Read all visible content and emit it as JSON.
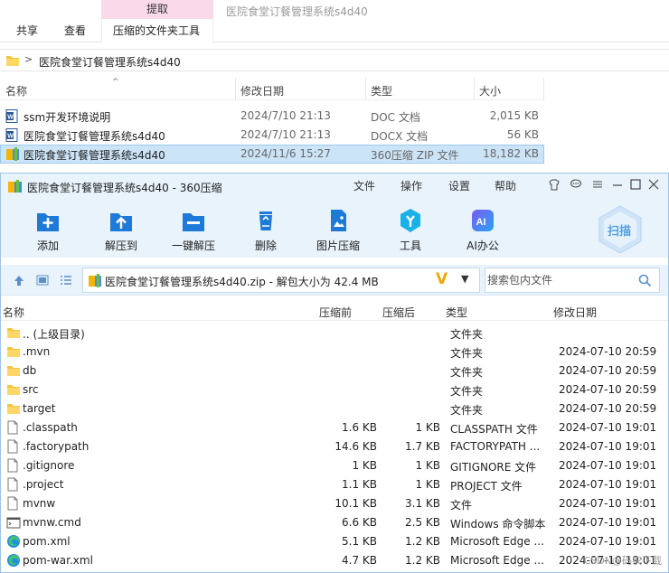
{
  "explorer": {
    "context_tab_header": "提取",
    "window_title": "医院食堂订餐管理系统s4d40",
    "tabs": [
      "共享",
      "查看",
      "压缩的文件夹工具"
    ],
    "breadcrumb": "医院食堂订餐管理系统s4d40",
    "columns": {
      "name": "名称",
      "date": "修改日期",
      "type": "类型",
      "size": "大小"
    },
    "files": [
      {
        "name": "ssm开发环境说明",
        "date": "2024/7/10 21:13",
        "type": "DOC 文档",
        "size": "2,015 KB",
        "icon": "word-doc-icon"
      },
      {
        "name": "医院食堂订餐管理系统s4d40",
        "date": "2024/7/10 21:13",
        "type": "DOCX 文档",
        "size": "56 KB",
        "icon": "word-doc-icon"
      },
      {
        "name": "医院食堂订餐管理系统s4d40",
        "date": "2024/11/6 15:27",
        "type": "360压缩 ZIP 文件",
        "size": "18,182 KB",
        "icon": "zip-archive-icon"
      }
    ]
  },
  "zip_window": {
    "title": "医院食堂订餐管理系统s4d40 - 360压缩",
    "menu": [
      "文件",
      "操作",
      "设置",
      "帮助"
    ],
    "toolbar": [
      "添加",
      "解压到",
      "一键解压",
      "删除",
      "图片压缩",
      "工具",
      "AI办公"
    ],
    "scan_label": "扫描",
    "path": "医院食堂订餐管理系统s4d40.zip - 解包大小为 42.4 MB",
    "search_placeholder": "搜索包内文件",
    "columns": {
      "name": "名称",
      "before": "压缩前",
      "after": "压缩后",
      "type": "类型",
      "modified": "修改日期"
    },
    "rows": [
      {
        "name": ".. (上级目录)",
        "before": "",
        "after": "",
        "type": "文件夹",
        "modified": "",
        "icon": "folder-icon"
      },
      {
        "name": ".mvn",
        "before": "",
        "after": "",
        "type": "文件夹",
        "modified": "2024-07-10 20:59",
        "icon": "folder-icon"
      },
      {
        "name": "db",
        "before": "",
        "after": "",
        "type": "文件夹",
        "modified": "2024-07-10 20:59",
        "icon": "folder-icon"
      },
      {
        "name": "src",
        "before": "",
        "after": "",
        "type": "文件夹",
        "modified": "2024-07-10 20:59",
        "icon": "folder-icon"
      },
      {
        "name": "target",
        "before": "",
        "after": "",
        "type": "文件夹",
        "modified": "2024-07-10 20:59",
        "icon": "folder-icon"
      },
      {
        "name": ".classpath",
        "before": "1.6 KB",
        "after": "1 KB",
        "type": "CLASSPATH 文件",
        "modified": "2024-07-10 19:01",
        "icon": "file-icon"
      },
      {
        "name": ".factorypath",
        "before": "14.6 KB",
        "after": "1.7 KB",
        "type": "FACTORYPATH ...",
        "modified": "2024-07-10 19:01",
        "icon": "file-icon"
      },
      {
        "name": ".gitignore",
        "before": "1 KB",
        "after": "1 KB",
        "type": "GITIGNORE 文件",
        "modified": "2024-07-10 19:01",
        "icon": "file-icon"
      },
      {
        "name": ".project",
        "before": "1.1 KB",
        "after": "1 KB",
        "type": "PROJECT 文件",
        "modified": "2024-07-10 19:01",
        "icon": "file-icon"
      },
      {
        "name": "mvnw",
        "before": "10.1 KB",
        "after": "3.1 KB",
        "type": "文件",
        "modified": "2024-07-10 19:01",
        "icon": "file-icon"
      },
      {
        "name": "mvnw.cmd",
        "before": "6.6 KB",
        "after": "2.5 KB",
        "type": "Windows 命令脚本",
        "modified": "2024-07-10 19:01",
        "icon": "cmd-script-icon"
      },
      {
        "name": "pom.xml",
        "before": "5.1 KB",
        "after": "1.2 KB",
        "type": "Microsoft Edge ...",
        "modified": "2024-07-10 19:01",
        "icon": "edge-icon"
      },
      {
        "name": "pom-war.xml",
        "before": "4.7 KB",
        "after": "1.2 KB",
        "type": "Microsoft Edge ...",
        "modified": "2024-07-10 19:01",
        "icon": "edge-icon"
      }
    ]
  },
  "watermark": "CSDN@码农下载"
}
